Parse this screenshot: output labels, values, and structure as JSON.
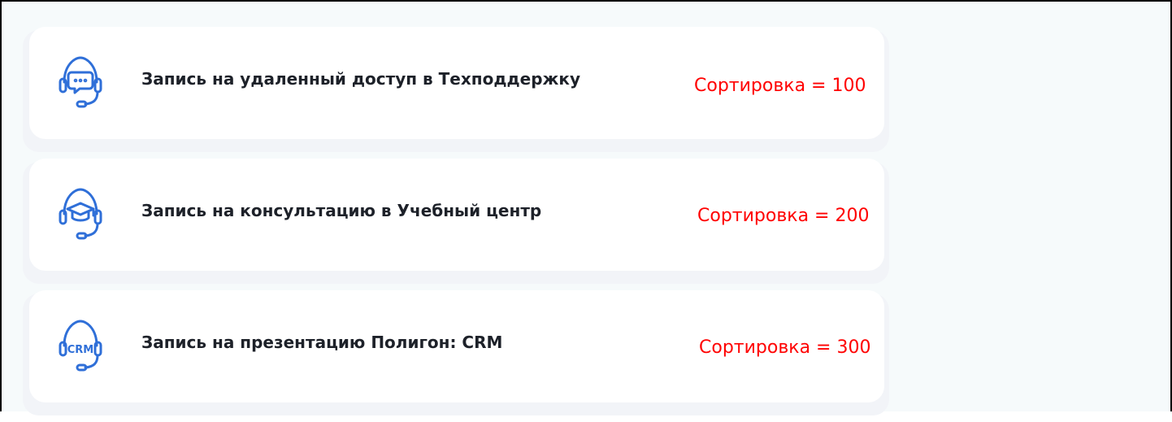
{
  "items": [
    {
      "icon": "headset-chat-icon",
      "title": "Запись на удаленный доступ в Техподдержку",
      "sort_label": "Сортировка = 100"
    },
    {
      "icon": "headset-graduation-cap-icon",
      "title": "Запись на консультацию в Учебный центр",
      "sort_label": "Сортировка = 200"
    },
    {
      "icon": "headset-crm-icon",
      "title": "Запись на презентацию Полигон: CRM",
      "sort_label": "Сортировка = 300",
      "icon_text": "CRM"
    }
  ],
  "colors": {
    "icon_blue": "#2f6fd8",
    "sort_red": "#ff0000",
    "title_text": "#1d2129",
    "background": "#f6fafb"
  }
}
